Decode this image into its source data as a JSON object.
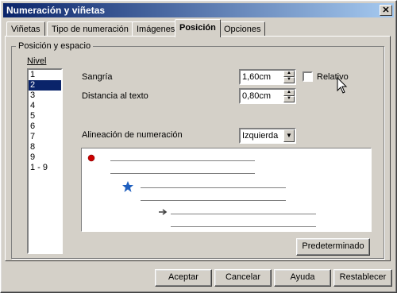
{
  "window": {
    "title": "Numeración y viñetas",
    "close_label": "✕"
  },
  "tabs": [
    {
      "label": "Viñetas",
      "active": false
    },
    {
      "label": "Tipo de numeración",
      "active": false
    },
    {
      "label": "Imágenes",
      "active": false
    },
    {
      "label": "Posición",
      "active": true
    },
    {
      "label": "Opciones",
      "active": false
    }
  ],
  "position": {
    "group_label": "Posición y espacio",
    "level_label": "Nivel",
    "levels": [
      "1",
      "2",
      "3",
      "4",
      "5",
      "6",
      "7",
      "8",
      "9",
      "1 - 9"
    ],
    "selected_level": "2",
    "indent": {
      "label": "Sangría",
      "value": "1,60cm"
    },
    "relative": {
      "label": "Relativo",
      "checked": false
    },
    "text_distance": {
      "label": "Distancia al texto",
      "value": "0,80cm"
    },
    "alignment": {
      "label": "Alineación de numeración",
      "value": "Izquierda"
    },
    "default_button": "Predeterminado"
  },
  "preview": {
    "bullet_colors": [
      "#cc0000",
      "#1f5fbf",
      "#606060"
    ]
  },
  "footer": {
    "ok": "Aceptar",
    "cancel": "Cancelar",
    "help": "Ayuda",
    "reset": "Restablecer"
  }
}
